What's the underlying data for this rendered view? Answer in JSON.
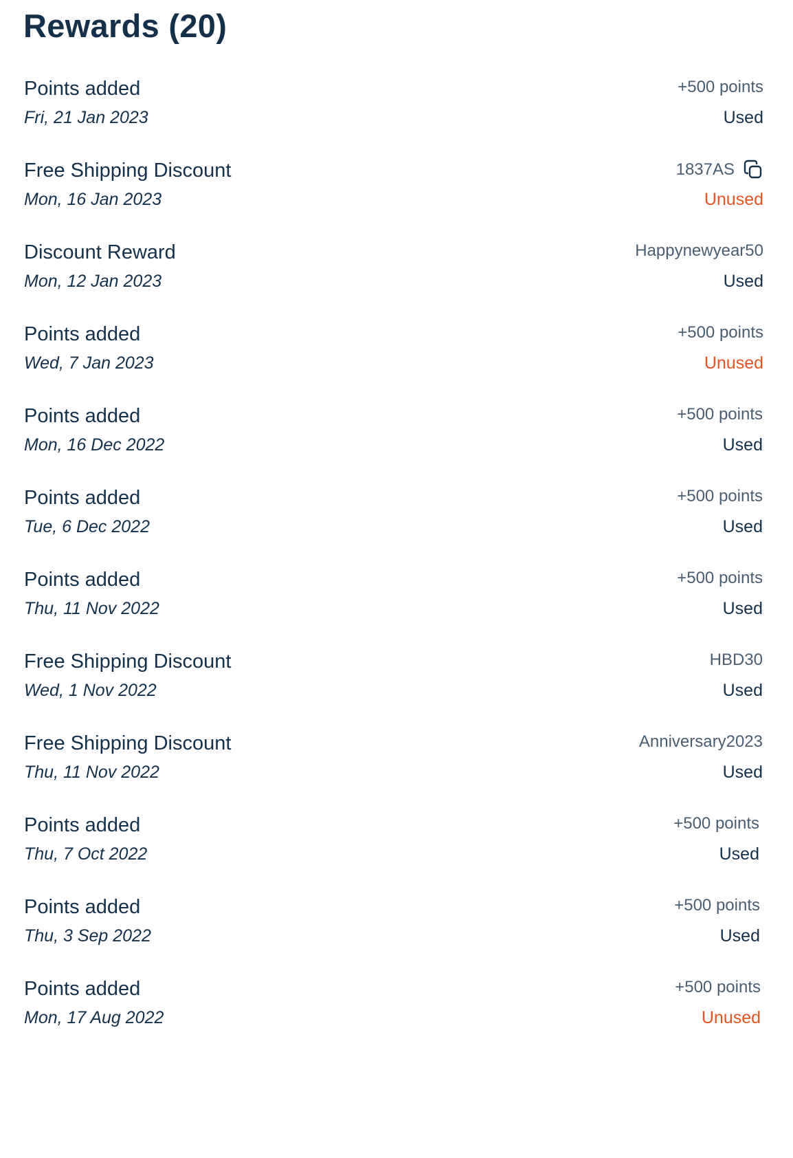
{
  "header": {
    "title": "Rewards (20)"
  },
  "colors": {
    "text": "#14304a",
    "muted": "#4a5d70",
    "unused": "#e65424"
  },
  "rewards": [
    {
      "label": "Points added",
      "date": "Fri, 21 Jan 2023",
      "value": "+500 points",
      "status": "Used",
      "copyable": false
    },
    {
      "label": "Free Shipping Discount",
      "date": "Mon, 16 Jan 2023",
      "value": "1837AS",
      "status": "Unused",
      "copyable": true
    },
    {
      "label": "Discount Reward",
      "date": "Mon, 12 Jan 2023",
      "value": "Happynewyear50",
      "status": "Used",
      "copyable": false
    },
    {
      "label": "Points added",
      "date": "Wed, 7 Jan 2023",
      "value": "+500 points",
      "status": "Unused",
      "copyable": false
    },
    {
      "label": "Points added",
      "date": "Mon, 16 Dec 2022",
      "value": "+500 points",
      "status": "Used",
      "copyable": false
    },
    {
      "label": "Points added",
      "date": "Tue, 6 Dec 2022",
      "value": "+500 points",
      "status": "Used",
      "copyable": false
    },
    {
      "label": "Points added",
      "date": "Thu, 11 Nov 2022",
      "value": "+500 points",
      "status": "Used",
      "copyable": false
    },
    {
      "label": "Free Shipping Discount",
      "date": "Wed, 1 Nov 2022",
      "value": "HBD30",
      "status": "Used",
      "copyable": false
    },
    {
      "label": "Free Shipping Discount",
      "date": "Thu, 11 Nov 2022",
      "value": "Anniversary2023",
      "status": "Used",
      "copyable": false
    },
    {
      "label": "Points added",
      "date": "Thu, 7 Oct 2022",
      "value": "+500 points",
      "status": "Used",
      "copyable": false
    },
    {
      "label": "Points added",
      "date": "Thu, 3 Sep 2022",
      "value": "+500 points",
      "status": "Used",
      "copyable": false
    },
    {
      "label": "Points added",
      "date": "Mon, 17 Aug 2022",
      "value": "+500 points",
      "status": "Unused",
      "copyable": false
    }
  ]
}
